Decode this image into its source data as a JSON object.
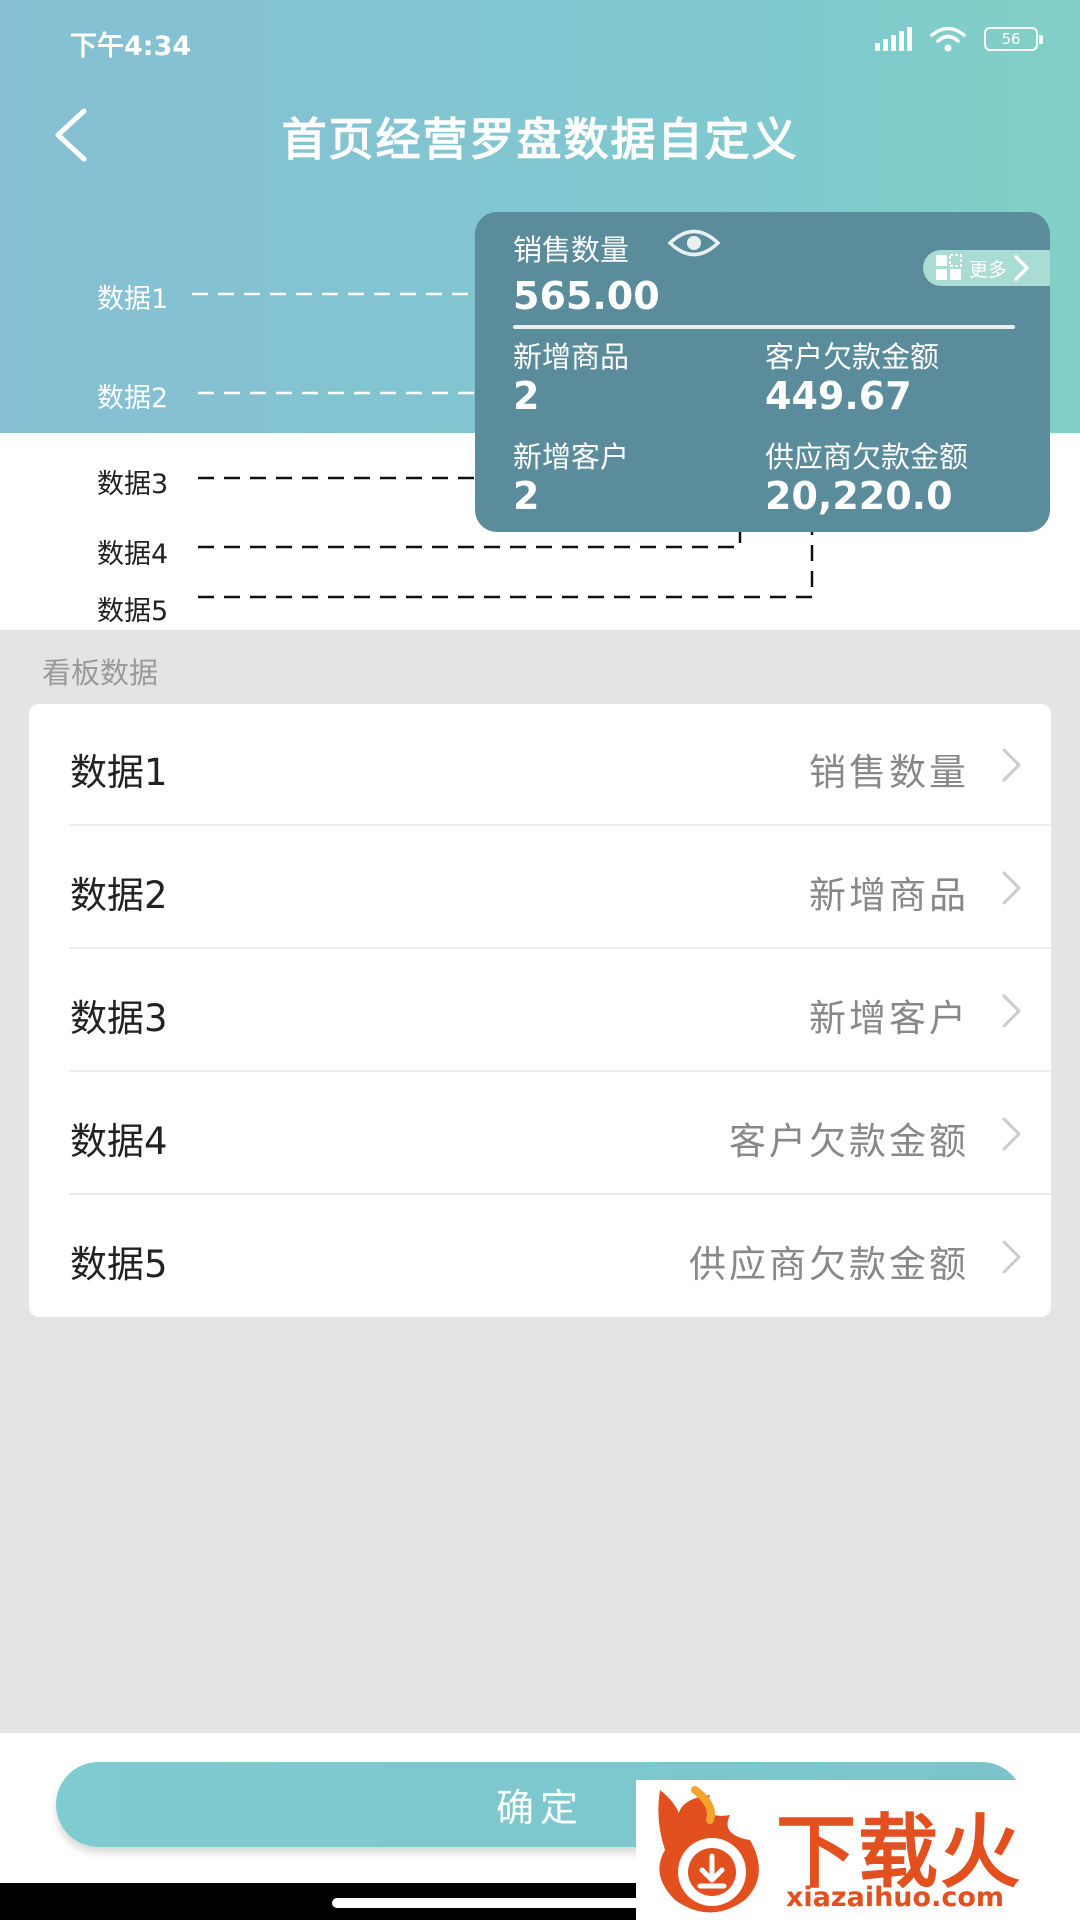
{
  "status_bar": {
    "time": "下午4:34",
    "battery": "56"
  },
  "nav": {
    "title": "首页经营罗盘数据自定义"
  },
  "preview": {
    "main_label": "销售数量",
    "main_value": "565.00",
    "more_label": "更多",
    "cells": [
      {
        "label": "新增商品",
        "value": "2"
      },
      {
        "label": "客户欠款金额",
        "value": "449.67"
      },
      {
        "label": "新增客户",
        "value": "2"
      },
      {
        "label": "供应商欠款金额",
        "value": "20,220.0"
      }
    ]
  },
  "guides": [
    "数据1",
    "数据2",
    "数据3",
    "数据4",
    "数据5"
  ],
  "section": {
    "title": "看板数据"
  },
  "list": [
    {
      "label": "数据1",
      "value": "销售数量"
    },
    {
      "label": "数据2",
      "value": "新增商品"
    },
    {
      "label": "数据3",
      "value": "新增客户"
    },
    {
      "label": "数据4",
      "value": "客户欠款金额"
    },
    {
      "label": "数据5",
      "value": "供应商欠款金额"
    }
  ],
  "confirm": {
    "label": "确定"
  },
  "watermark": {
    "brand": "下载火",
    "url": "xiazaihuo.com"
  },
  "colors": {
    "header": "#7fc4d0",
    "card": "#5a8c9c",
    "button": "#7ecbd0",
    "watermark": "#e3501f"
  }
}
